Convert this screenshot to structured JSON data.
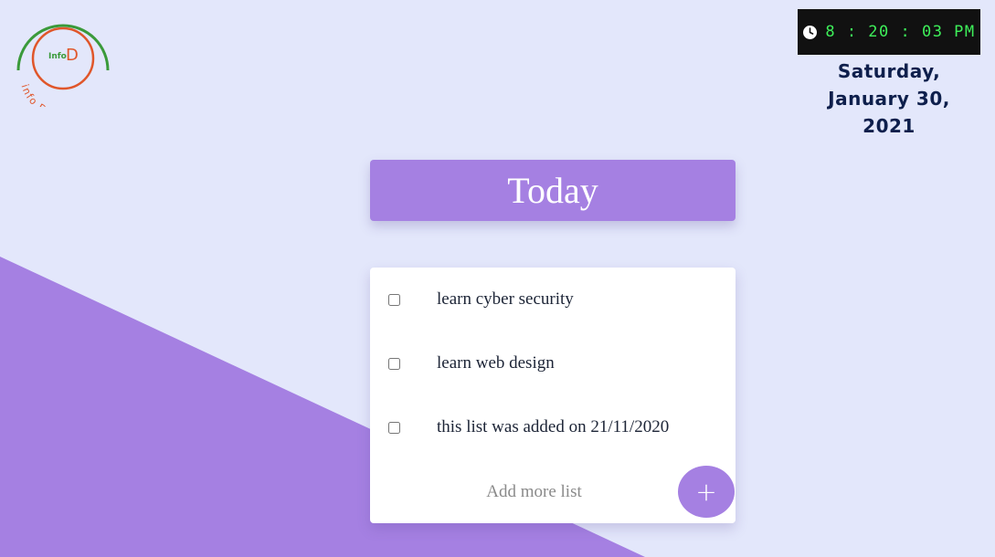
{
  "logo": {
    "top_text": "Info",
    "mark": "D",
    "arc_text": "info Designs",
    "colors": {
      "green": "#3a9a3a",
      "orange": "#e0562a"
    }
  },
  "clock": {
    "icon": "clock-icon",
    "time": "8 : 20 : 03 PM",
    "time_color": "#3ef05a"
  },
  "date": {
    "line1": "Saturday,",
    "line2": "January 30,",
    "line3": "2021"
  },
  "header": {
    "title": "Today"
  },
  "todos": [
    {
      "label": "learn cyber security",
      "checked": false
    },
    {
      "label": "learn web design",
      "checked": false
    },
    {
      "label": "this list was added on 21/11/2020",
      "checked": false
    }
  ],
  "add": {
    "placeholder": "Add more list",
    "button_label": "+"
  },
  "colors": {
    "background": "#e3e7fb",
    "accent": "#a580e2",
    "card": "#ffffff",
    "date_text": "#0e1f4c"
  }
}
